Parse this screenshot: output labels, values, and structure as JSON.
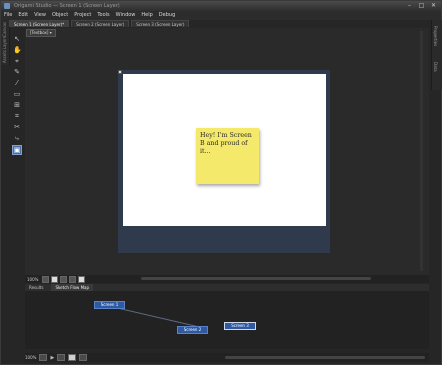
{
  "window": {
    "title": "Origami Studio — Screen 1 (Screen Layer)",
    "min": "–",
    "max": "□",
    "close": "✕"
  },
  "menu": [
    "File",
    "Edit",
    "View",
    "Object",
    "Project",
    "Tools",
    "Window",
    "Help",
    "Debug"
  ],
  "doc_tabs": [
    "Screen 1 (Screen Layer)*",
    "Screen 2 (Screen Layer)",
    "Screen 3 (Screen Layer)"
  ],
  "left_rail": [
    "Canvas",
    "Layers",
    "Assets"
  ],
  "tools": [
    "↖",
    "✋",
    "⌖",
    "✎",
    "⁄",
    "▭",
    "⊞",
    "⌗",
    "✂",
    "⤷",
    "▣"
  ],
  "canvas": {
    "chip": "[Textbox] ▾",
    "sticky_text": "Hey! I'm Screen B and proud of it..."
  },
  "canvas_bar": {
    "zoom": "100%"
  },
  "right_rail": [
    "Properties",
    "Data"
  ],
  "panel_tabs": [
    "Results",
    "Sketch Flow Map"
  ],
  "flow": {
    "nodes": [
      "Screen 1",
      "Screen 2",
      "Screen 3"
    ]
  },
  "status": {
    "zoom": "100%"
  }
}
